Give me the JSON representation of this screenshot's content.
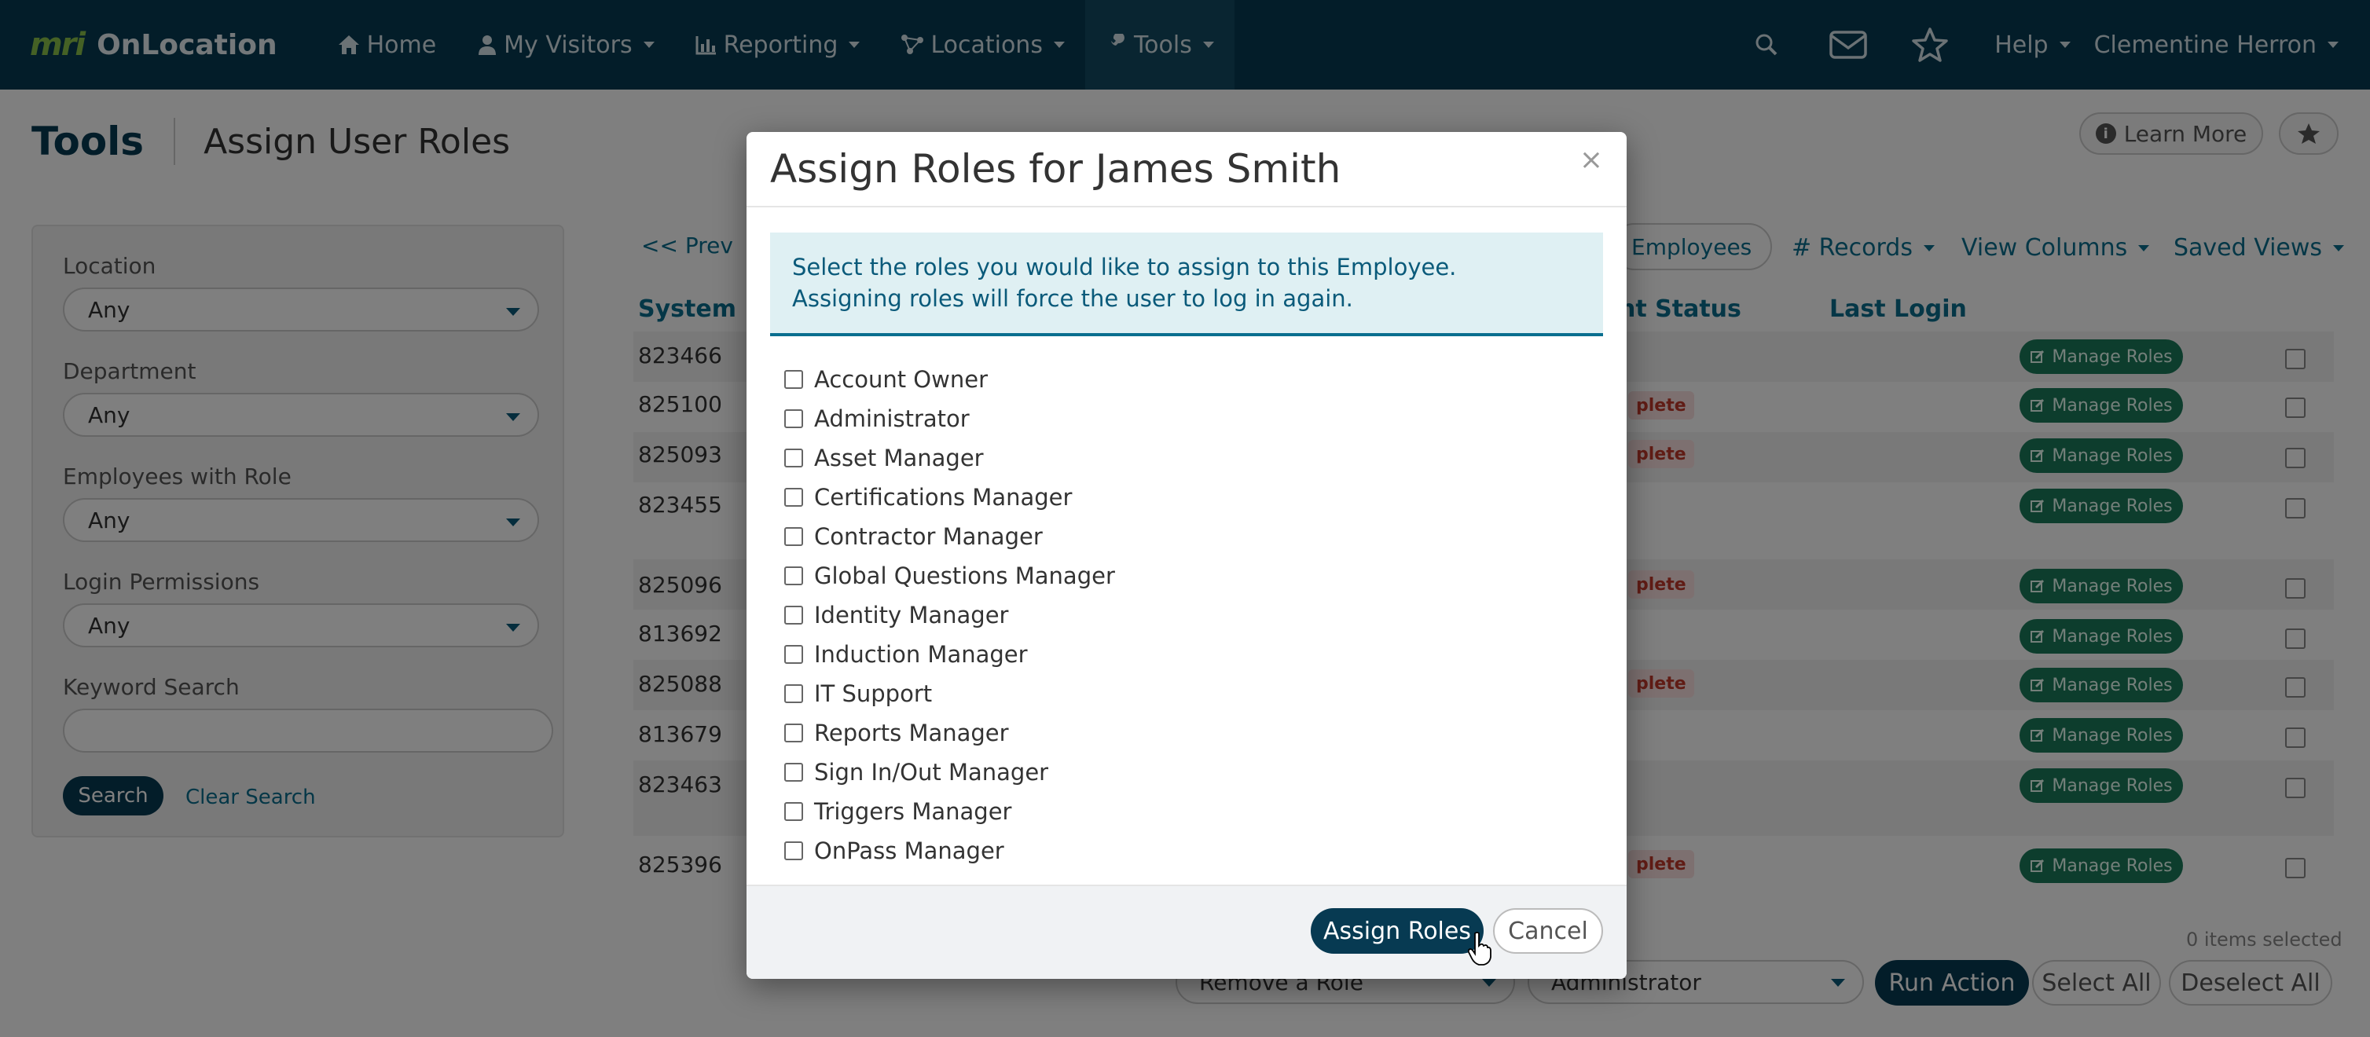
{
  "navbar": {
    "brand_logo": "mri",
    "brand_name": "OnLocation",
    "items": [
      {
        "label": "Home",
        "icon": "home-icon"
      },
      {
        "label": "My Visitors",
        "icon": "user-icon"
      },
      {
        "label": "Reporting",
        "icon": "bar-chart-icon"
      },
      {
        "label": "Locations",
        "icon": "sitemap-icon"
      },
      {
        "label": "Tools",
        "icon": "wrench-icon"
      }
    ],
    "help_label": "Help",
    "user_name": "Clementine Herron"
  },
  "page": {
    "title": "Tools",
    "subtitle": "Assign User Roles",
    "learn_more_label": "Learn More"
  },
  "sidebar": {
    "location_label": "Location",
    "location_value": "Any",
    "department_label": "Department",
    "department_value": "Any",
    "employees_role_label": "Employees with Role",
    "employees_role_value": "Any",
    "login_permissions_label": "Login Permissions",
    "login_permissions_value": "Any",
    "keyword_label": "Keyword Search",
    "keyword_value": "",
    "search_label": "Search",
    "clear_label": "Clear Search"
  },
  "list": {
    "prev_label": "<< Prev",
    "employees_label": "Employees",
    "records_label": "# Records",
    "view_columns_label": "View Columns",
    "saved_views_label": "Saved Views",
    "col_system_id": "System ID",
    "col_status": "nt Status",
    "col_last_login": "Last Login",
    "manage_label": "Manage Roles",
    "incomplete_label": "plete",
    "rows": [
      {
        "id": "823466",
        "incomplete": false
      },
      {
        "id": "825100",
        "incomplete": true
      },
      {
        "id": "825093",
        "incomplete": true
      },
      {
        "id": "823455",
        "incomplete": false
      },
      {
        "id": "825096",
        "incomplete": true
      },
      {
        "id": "813692",
        "incomplete": false
      },
      {
        "id": "825088",
        "incomplete": true
      },
      {
        "id": "813679",
        "incomplete": false
      },
      {
        "id": "823463",
        "incomplete": false
      },
      {
        "id": "825396",
        "incomplete": true
      }
    ],
    "items_selected": "0 items selected",
    "action_select": "Remove a Role",
    "role_select": "Administrator",
    "run_action_label": "Run Action",
    "select_all_label": "Select All",
    "deselect_all_label": "Deselect All"
  },
  "modal": {
    "title": "Assign Roles for James Smith",
    "close_glyph": "×",
    "alert": "Select the roles you would like to assign to this Employee. Assigning roles will force the user to log in again.",
    "roles": [
      "Account Owner",
      "Administrator",
      "Asset Manager",
      "Certifications Manager",
      "Contractor Manager",
      "Global Questions Manager",
      "Identity Manager",
      "Induction Manager",
      "IT Support",
      "Reports Manager",
      "Sign In/Out Manager",
      "Triggers Manager",
      "OnPass Manager"
    ],
    "assign_label": "Assign Roles",
    "cancel_label": "Cancel"
  }
}
